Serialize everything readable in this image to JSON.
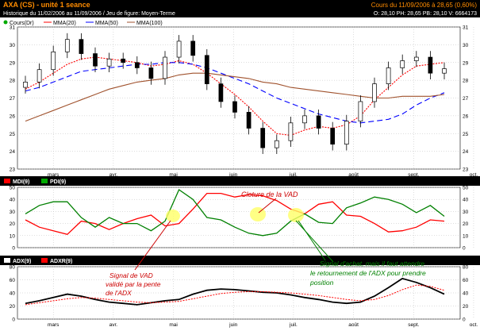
{
  "header": {
    "title": "AXA (CS) - unité 1 seance",
    "history": "Historique du 11/02/2006 au 11/09/2006 / Jeu de figure: Moyen-Terme",
    "quote": "Cours du 11/09/2006 à 28,65 (0,60%)",
    "ohlc": "O: 28,10 PH: 28,65 PB: 28,10 V: 6664173"
  },
  "colors": {
    "header_bg": "#000000",
    "header_accent": "#ff8c00",
    "price_up": "#ffffff",
    "price_down": "#000000",
    "mma20": "#ff0000",
    "mma50": "#0000ff",
    "mma100": "#a0522d",
    "mdi": "#ff0000",
    "pdi": "#008000",
    "adx": "#000000",
    "adxr": "#ff0000",
    "highlight": "#ffff66",
    "annotation_red": "#cc0000",
    "annotation_green": "#008000"
  },
  "legend": {
    "price": [
      "Cours(Dr)",
      "MMA(20)",
      "MMA(50)",
      "MMA(100)"
    ],
    "dmi": [
      "MDI(9)",
      "PDI(9)"
    ],
    "adx": [
      "ADX(9)",
      "ADXR(9)"
    ]
  },
  "months": [
    "mars",
    "avr.",
    "mai",
    "juin",
    "juil.",
    "août",
    "sept.",
    "oct."
  ],
  "annotations": {
    "vad_close": "Cloture de la VAD",
    "vad_signal": [
      "Signal de VAD",
      "validé par la pente",
      "de l'ADX"
    ],
    "buy_signal": [
      "Signal d'achat, mais il faut attendre",
      "le retournement de l'ADX pour prendre",
      "position"
    ]
  },
  "chart_data": [
    {
      "type": "candlestick",
      "ylim": [
        23,
        31
      ],
      "yticks": [
        23,
        24,
        25,
        26,
        27,
        28,
        29,
        30,
        31
      ],
      "x": [
        "13/02",
        "20/02",
        "27/02",
        "06/03",
        "13/03",
        "20/03",
        "27/03",
        "03/04",
        "10/04",
        "17/04",
        "24/04",
        "01/05",
        "08/05",
        "15/05",
        "22/05",
        "29/05",
        "05/06",
        "12/06",
        "19/06",
        "26/06",
        "03/07",
        "10/07",
        "17/07",
        "24/07",
        "31/07",
        "07/08",
        "14/08",
        "21/08",
        "28/08",
        "04/09",
        "11/09"
      ],
      "close": [
        27.9,
        28.6,
        29.6,
        30.3,
        29.5,
        28.8,
        29.2,
        29.0,
        28.7,
        28.1,
        29.3,
        30.2,
        29.4,
        27.8,
        26.8,
        26.2,
        25.3,
        24.2,
        24.6,
        25.6,
        26.0,
        25.3,
        24.4,
        25.7,
        26.8,
        27.8,
        28.7,
        29.1,
        29.3,
        28.4,
        28.65
      ],
      "series": [
        {
          "name": "MMA(20)",
          "values": [
            27.5,
            27.9,
            28.4,
            28.9,
            29.2,
            29.3,
            29.2,
            29.1,
            29.0,
            28.8,
            28.9,
            29.1,
            28.9,
            28.4,
            27.8,
            27.2,
            26.5,
            25.7,
            25.0,
            24.9,
            25.2,
            25.4,
            25.3,
            25.5,
            26.0,
            26.9,
            27.6,
            28.3,
            28.8,
            28.9,
            29.0
          ]
        },
        {
          "name": "MMA(50)",
          "values": [
            27.4,
            27.6,
            27.9,
            28.2,
            28.5,
            28.6,
            28.7,
            28.8,
            28.9,
            28.9,
            29.0,
            29.0,
            28.9,
            28.7,
            28.4,
            28.1,
            27.8,
            27.4,
            27.0,
            26.7,
            26.4,
            26.1,
            25.9,
            25.7,
            25.6,
            25.7,
            25.8,
            26.1,
            26.6,
            27.0,
            27.3
          ]
        },
        {
          "name": "MMA(100)",
          "values": [
            25.7,
            26.0,
            26.3,
            26.6,
            26.9,
            27.2,
            27.5,
            27.7,
            27.9,
            28.0,
            28.1,
            28.3,
            28.4,
            28.4,
            28.3,
            28.2,
            28.1,
            27.9,
            27.8,
            27.6,
            27.5,
            27.4,
            27.3,
            27.2,
            27.1,
            27.0,
            27.0,
            27.1,
            27.1,
            27.1,
            27.2
          ]
        }
      ]
    },
    {
      "type": "line",
      "ylim": [
        0,
        50
      ],
      "yticks": [
        0,
        10,
        20,
        30,
        40,
        50
      ],
      "series": [
        {
          "name": "MDI(9)",
          "values": [
            23,
            17,
            14,
            11,
            22,
            20,
            15,
            20,
            24,
            27,
            18,
            20,
            32,
            45,
            45,
            42,
            44,
            43,
            39,
            32,
            28,
            36,
            38,
            27,
            26,
            20,
            13,
            14,
            17,
            23,
            22
          ]
        },
        {
          "name": "PDI(9)",
          "values": [
            28,
            35,
            38,
            38,
            25,
            17,
            25,
            20,
            20,
            14,
            22,
            48,
            40,
            25,
            23,
            17,
            12,
            10,
            12,
            22,
            28,
            21,
            20,
            33,
            37,
            42,
            40,
            36,
            29,
            35,
            26
          ]
        }
      ]
    },
    {
      "type": "line",
      "ylim": [
        0,
        80
      ],
      "yticks": [
        0,
        20,
        40,
        60,
        80
      ],
      "series": [
        {
          "name": "ADX(9)",
          "values": [
            24,
            28,
            33,
            38,
            35,
            30,
            26,
            24,
            22,
            25,
            28,
            30,
            38,
            44,
            46,
            45,
            43,
            41,
            40,
            37,
            33,
            30,
            26,
            24,
            26,
            35,
            48,
            62,
            56,
            48,
            38
          ]
        },
        {
          "name": "ADXR(9)",
          "values": [
            22,
            25,
            28,
            31,
            33,
            32,
            30,
            28,
            26,
            25,
            26,
            27,
            31,
            35,
            39,
            41,
            42,
            42,
            41,
            40,
            38,
            36,
            33,
            30,
            28,
            30,
            36,
            45,
            52,
            50,
            44
          ]
        }
      ]
    }
  ]
}
